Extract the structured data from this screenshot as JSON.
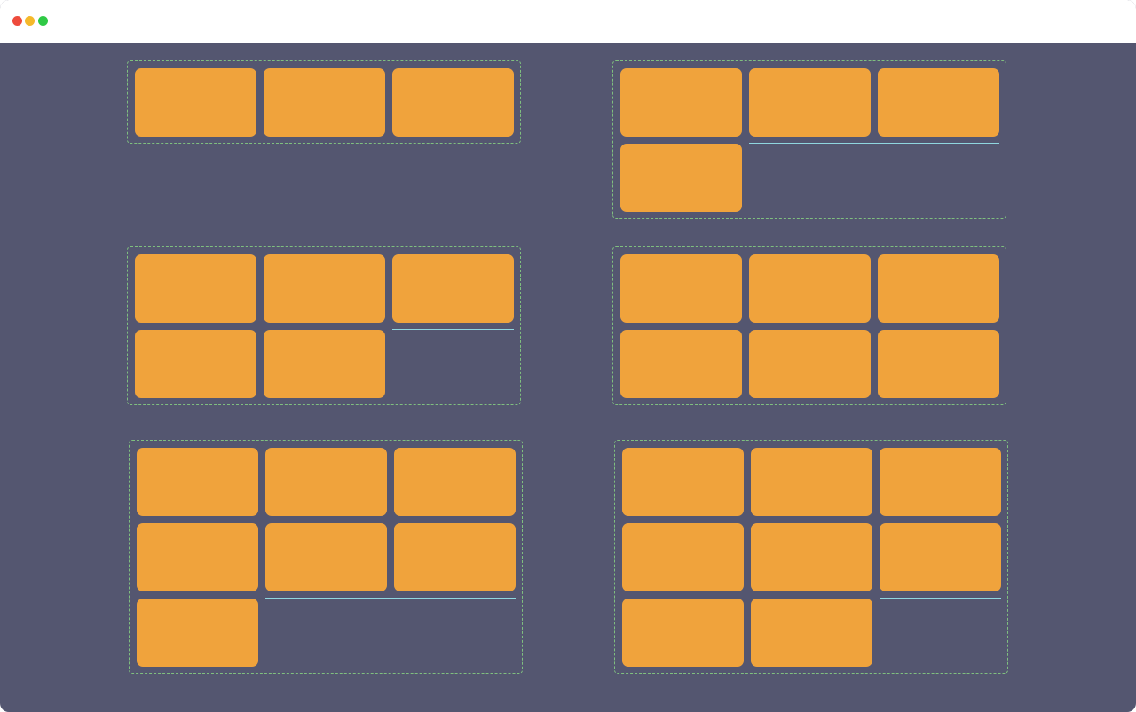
{
  "window": {
    "background": "#545670",
    "titlebar_background": "#ffffff",
    "controls": [
      {
        "name": "close-dot",
        "color": "#ee4b3c"
      },
      {
        "name": "minimize-dot",
        "color": "#f5b92b"
      },
      {
        "name": "maximize-dot",
        "color": "#2fc945"
      }
    ]
  },
  "colors": {
    "item": "#f0a33c",
    "guide": "#8fd6df",
    "panel_border": "#7fbf7f"
  },
  "panels": [
    {
      "id": "p1",
      "item_count": 3,
      "columns": 3,
      "has_guide": false
    },
    {
      "id": "p2",
      "item_count": 4,
      "columns": 3,
      "has_guide": true
    },
    {
      "id": "p3",
      "item_count": 5,
      "columns": 3,
      "has_guide": true
    },
    {
      "id": "p4",
      "item_count": 6,
      "columns": 3,
      "has_guide": false
    },
    {
      "id": "p5",
      "item_count": 7,
      "columns": 3,
      "has_guide": true
    },
    {
      "id": "p6",
      "item_count": 8,
      "columns": 3,
      "has_guide": true
    }
  ]
}
